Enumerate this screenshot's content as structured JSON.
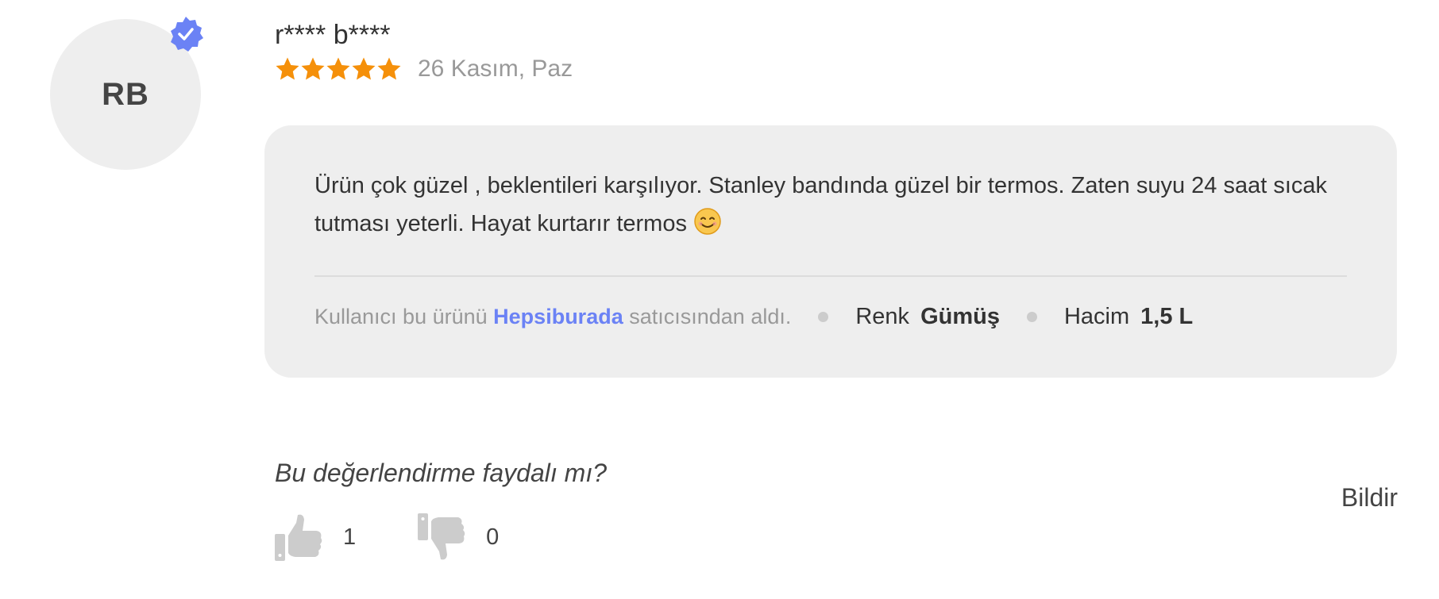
{
  "reviewer": {
    "initials": "RB",
    "name": "r**** b****",
    "verified_icon": "verified-badge-icon",
    "badge_color": "#6b82f5"
  },
  "rating": {
    "stars": 5,
    "max": 5,
    "star_color": "#f5900a"
  },
  "date": "26 Kasım, Paz",
  "review": {
    "text": "Ürün çok güzel , beklentileri karşılıyor. Stanley bandında güzel bir termos. Zaten suyu 24 saat sıcak tutması yeterli. Hayat kurtarır termos",
    "emoji_icon": "smiling-face-icon"
  },
  "seller": {
    "prefix": "Kullanıcı bu ürünü",
    "name": "Hepsiburada",
    "suffix": "satıcısından aldı.",
    "link_color": "#6b82f5"
  },
  "attributes": [
    {
      "label": "Renk",
      "value": "Gümüş"
    },
    {
      "label": "Hacim",
      "value": "1,5 L"
    }
  ],
  "helpful": {
    "question": "Bu değerlendirme faydalı mı?",
    "likes": "1",
    "dislikes": "0",
    "like_icon": "thumbs-up-icon",
    "dislike_icon": "thumbs-down-icon"
  },
  "report_label": "Bildir"
}
